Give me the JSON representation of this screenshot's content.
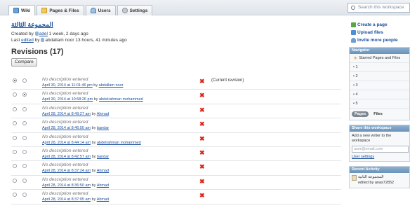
{
  "tabs": [
    {
      "label": "Wiki",
      "icon": "wiki-icon",
      "active": true
    },
    {
      "label": "Pages & Files",
      "icon": "pages-icon",
      "active": false
    },
    {
      "label": "Users",
      "icon": "users-icon",
      "active": false
    },
    {
      "label": "Settings",
      "icon": "settings-icon",
      "active": false
    }
  ],
  "search": {
    "placeholder": "Search this workspace"
  },
  "page": {
    "title": "المجموعة الثالثة",
    "created_prefix": "Created by",
    "created_user": "adel",
    "created_suffix": "1 week, 2 days ago",
    "edited_prefix": "Last",
    "edited_link": "edited",
    "edited_by": "by",
    "edited_user": "abdallam noor",
    "edited_suffix": "13 hours, 41 minutes ago"
  },
  "revisions": {
    "heading": "Revisions (17)",
    "compare_label": "Compare",
    "current_label": "(Current revision)",
    "rows": [
      {
        "desc": "No description entered",
        "date": "April 30, 2014 at 11:01:46 pm",
        "by": "by",
        "user": "abdallam noor",
        "radio1": true,
        "radio2": false,
        "current": true
      },
      {
        "desc": "No description entered",
        "date": "April 30, 2014 at 10:58:26 pm",
        "by": "by",
        "user": "abdelrahman mohammed",
        "radio1": false,
        "radio2": true,
        "current": false
      },
      {
        "desc": "No description entered",
        "date": "April 28, 2014 at 8:49:27 am",
        "by": "by",
        "user": "Ahmad",
        "radio1": false,
        "radio2": false,
        "current": false
      },
      {
        "desc": "No description entered",
        "date": "April 28, 2014 at 8:46:50 am",
        "by": "by",
        "user": "bandar",
        "radio1": false,
        "radio2": false,
        "current": false
      },
      {
        "desc": "No description entered",
        "date": "April 28, 2014 at 8:44:14 am",
        "by": "by",
        "user": "abdelrahman mohammed",
        "radio1": false,
        "radio2": false,
        "current": false
      },
      {
        "desc": "No description entered",
        "date": "April 28, 2014 at 8:42:57 am",
        "by": "by",
        "user": "bandar",
        "radio1": false,
        "radio2": false,
        "current": false
      },
      {
        "desc": "No description entered",
        "date": "April 28, 2014 at 8:37:24 am",
        "by": "by",
        "user": "Ahmad",
        "radio1": false,
        "radio2": false,
        "current": false
      },
      {
        "desc": "No description entered",
        "date": "April 28, 2014 at 8:36:50 am",
        "by": "by",
        "user": "Ahmad",
        "radio1": false,
        "radio2": false,
        "current": false
      },
      {
        "desc": "No description entered",
        "date": "April 28, 2014 at 8:37:05 am",
        "by": "by",
        "user": "Ahmad",
        "radio1": false,
        "radio2": false,
        "current": false
      }
    ]
  },
  "sidebar": {
    "actions": [
      {
        "label": "Create a page",
        "icon": "create-page-icon"
      },
      {
        "label": "Upload files",
        "icon": "upload-icon"
      },
      {
        "label": "Invite more people",
        "icon": "invite-icon"
      }
    ],
    "navigator": {
      "heading": "Navigator",
      "starred": "Starred Pages and Files",
      "items": [
        "1",
        "2",
        "3",
        "4",
        "5"
      ],
      "subtab_pages": "Pages",
      "subtab_files": "Files"
    },
    "share": {
      "heading": "Share this workspace",
      "text": "Add a new writer to the workspace",
      "email_placeholder": "user@email.com",
      "settings_link": "User settings"
    },
    "activity": {
      "heading": "Recent Activity",
      "item_title": "المجموعة الثانية",
      "item_meta": "edited by anas72852"
    }
  },
  "colors": {
    "link": "#1a4f9c",
    "delete": "#d9261c",
    "panel_header": "#7a9fc4"
  }
}
